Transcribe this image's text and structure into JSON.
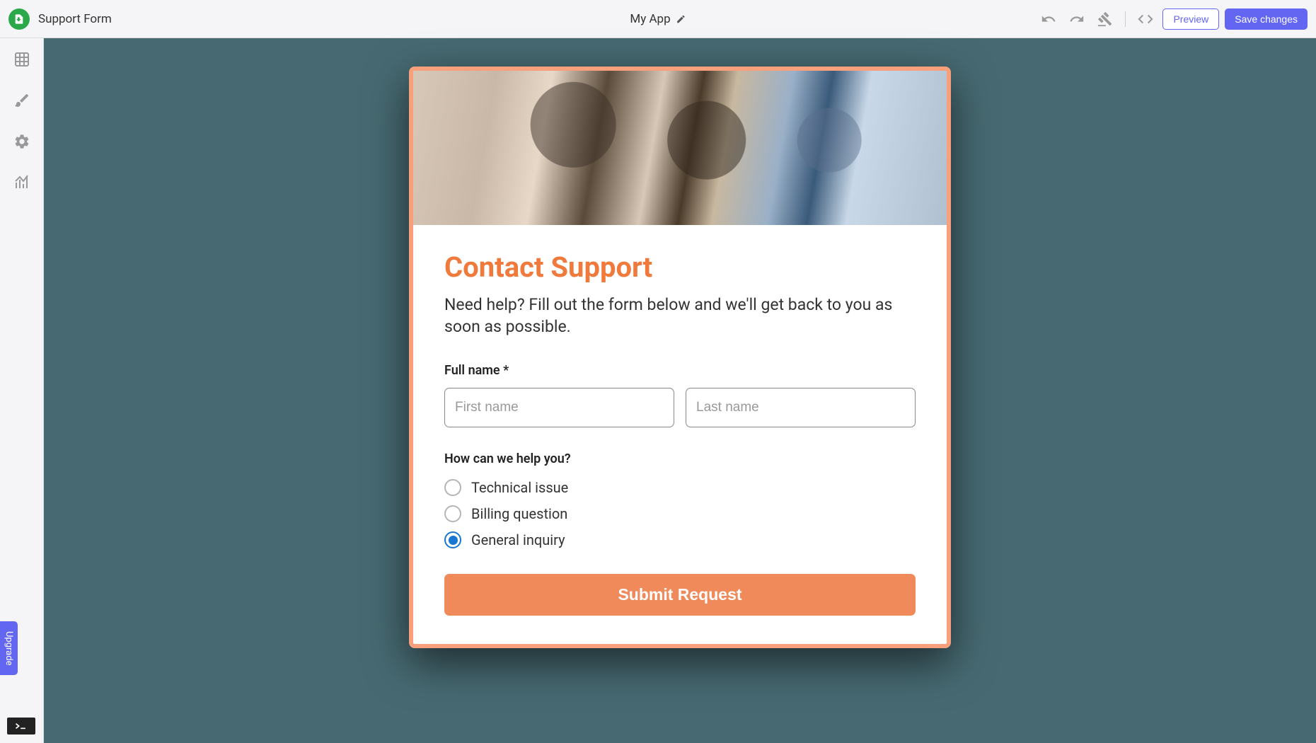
{
  "topbar": {
    "page_title": "Support Form",
    "app_name": "My App",
    "preview_label": "Preview",
    "save_label": "Save changes"
  },
  "sidebar": {
    "upgrade_label": "Upgrade"
  },
  "form": {
    "title": "Contact Support",
    "subtitle": "Need help? Fill out the form below and we'll get back to you as soon as possible.",
    "full_name_label": "Full name *",
    "first_name_placeholder": "First name",
    "last_name_placeholder": "Last name",
    "help_label": "How can we help you?",
    "options": [
      {
        "label": "Technical issue",
        "checked": false
      },
      {
        "label": "Billing question",
        "checked": false
      },
      {
        "label": "General inquiry",
        "checked": true
      }
    ],
    "submit_label": "Submit Request"
  },
  "colors": {
    "accent_orange": "#f07a3b",
    "accent_blue": "#6366f1",
    "canvas_bg": "#476a72"
  }
}
